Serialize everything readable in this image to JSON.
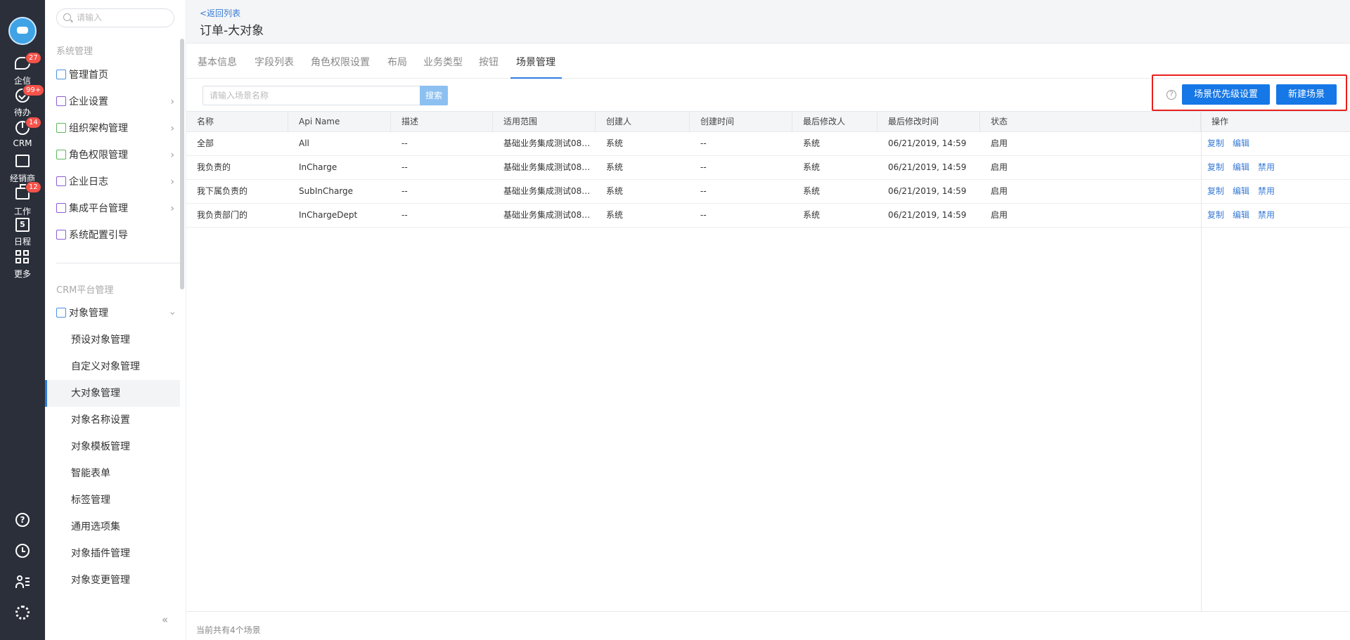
{
  "rail": {
    "items": [
      {
        "label": "企信",
        "badge": "27",
        "icon": "chat-bubble-icon"
      },
      {
        "label": "待办",
        "badge": "99+",
        "icon": "check-circle-icon"
      },
      {
        "label": "CRM",
        "badge": "14",
        "icon": "pie-chart-icon"
      },
      {
        "label": "经销商",
        "badge": "",
        "icon": "store-icon"
      },
      {
        "label": "工作",
        "badge": "12",
        "icon": "briefcase-icon"
      },
      {
        "label": "日程",
        "badge": "",
        "icon": "calendar-icon",
        "day": "5"
      },
      {
        "label": "更多",
        "badge": "",
        "icon": "grid-icon"
      }
    ],
    "bottom_icons": [
      "help-icon",
      "clock-icon",
      "user-list-icon",
      "settings-gear-icon"
    ]
  },
  "sidebar": {
    "search_placeholder": "请输入",
    "group_system": "系统管理",
    "system_items": [
      {
        "label": "管理首页",
        "icon": "home-icon",
        "has_arrow": false
      },
      {
        "label": "企业设置",
        "icon": "building-icon",
        "has_arrow": true
      },
      {
        "label": "组织架构管理",
        "icon": "org-tree-icon",
        "has_arrow": true
      },
      {
        "label": "角色权限管理",
        "icon": "id-card-icon",
        "has_arrow": true
      },
      {
        "label": "企业日志",
        "icon": "log-icon",
        "has_arrow": true
      },
      {
        "label": "集成平台管理",
        "icon": "chip-icon",
        "has_arrow": true
      },
      {
        "label": "系统配置引导",
        "icon": "signpost-icon",
        "has_arrow": false
      }
    ],
    "group_crm": "CRM平台管理",
    "object_mgmt": {
      "label": "对象管理",
      "icon": "object-icon"
    },
    "sub_items": [
      "预设对象管理",
      "自定义对象管理",
      "大对象管理",
      "对象名称设置",
      "对象模板管理",
      "智能表单",
      "标签管理",
      "通用选项集",
      "对象插件管理",
      "对象变更管理"
    ],
    "active_sub": "大对象管理",
    "collapse_icon": "double-chevron-left-icon"
  },
  "header": {
    "back_link": "<返回列表",
    "title": "订单-大对象"
  },
  "tabs": [
    "基本信息",
    "字段列表",
    "角色权限设置",
    "布局",
    "业务类型",
    "按钮",
    "场景管理"
  ],
  "active_tab": "场景管理",
  "toolbar": {
    "search_placeholder": "请输入场景名称",
    "search_button": "搜索",
    "priority_button": "场景优先级设置",
    "new_button": "新建场景",
    "accent": "#1677e6",
    "highlight_color": "#e8201c"
  },
  "table": {
    "columns": [
      "名称",
      "Api Name",
      "描述",
      "适用范围",
      "创建人",
      "创建时间",
      "最后修改人",
      "最后修改时间",
      "状态",
      "操作"
    ],
    "rows": [
      {
        "name": "全部",
        "api": "All",
        "desc": "--",
        "scope": "基础业务集成测试0871...",
        "creator": "系统",
        "created": "--",
        "modifier": "系统",
        "modified": "06/21/2019, 14:59",
        "status": "启用",
        "ops": [
          "复制",
          "编辑"
        ]
      },
      {
        "name": "我负责的",
        "api": "InCharge",
        "desc": "--",
        "scope": "基础业务集成测试0871...",
        "creator": "系统",
        "created": "--",
        "modifier": "系统",
        "modified": "06/21/2019, 14:59",
        "status": "启用",
        "ops": [
          "复制",
          "编辑",
          "禁用"
        ]
      },
      {
        "name": "我下属负责的",
        "api": "SubInCharge",
        "desc": "--",
        "scope": "基础业务集成测试0871...",
        "creator": "系统",
        "created": "--",
        "modifier": "系统",
        "modified": "06/21/2019, 14:59",
        "status": "启用",
        "ops": [
          "复制",
          "编辑",
          "禁用"
        ]
      },
      {
        "name": "我负责部门的",
        "api": "InChargeDept",
        "desc": "--",
        "scope": "基础业务集成测试0871...",
        "creator": "系统",
        "created": "--",
        "modifier": "系统",
        "modified": "06/21/2019, 14:59",
        "status": "启用",
        "ops": [
          "复制",
          "编辑",
          "禁用"
        ]
      }
    ]
  },
  "footer": {
    "summary": "当前共有4个场景"
  }
}
